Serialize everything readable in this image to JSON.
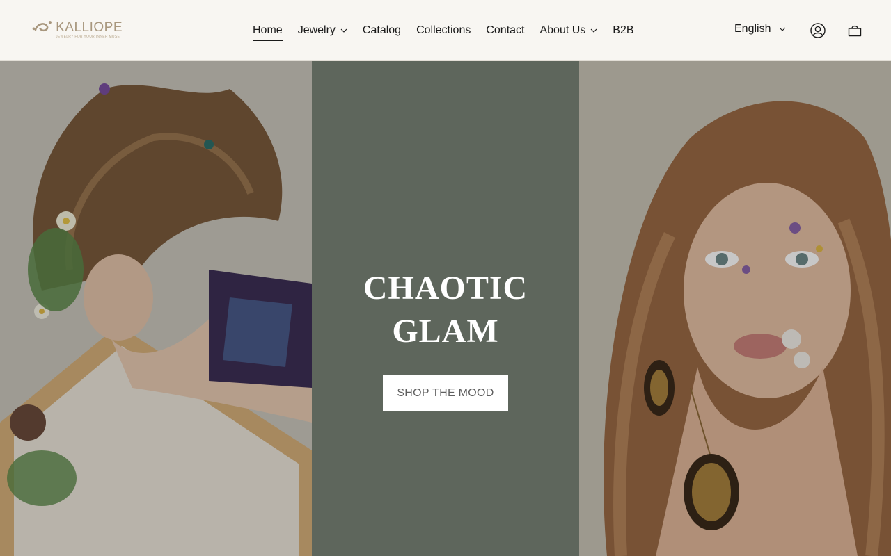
{
  "brand": {
    "name": "KALLIOPE",
    "tagline": "JEWELRY FOR YOUR INNER MUSE",
    "color": "#a8977e"
  },
  "nav": {
    "items": [
      {
        "label": "Home",
        "active": true,
        "dropdown": false
      },
      {
        "label": "Jewelry",
        "active": false,
        "dropdown": true
      },
      {
        "label": "Catalog",
        "active": false,
        "dropdown": false
      },
      {
        "label": "Collections",
        "active": false,
        "dropdown": false
      },
      {
        "label": "Contact",
        "active": false,
        "dropdown": false
      },
      {
        "label": "About Us",
        "active": false,
        "dropdown": true
      },
      {
        "label": "B2B",
        "active": false,
        "dropdown": false
      }
    ]
  },
  "language": {
    "selected": "English"
  },
  "icons": {
    "account": "account-icon",
    "cart": "cart-icon"
  },
  "hero": {
    "title_line1": "CHAOTIC",
    "title_line2": "GLAM",
    "button_label": "SHOP THE MOOD",
    "bg_color": "#5e665c"
  }
}
